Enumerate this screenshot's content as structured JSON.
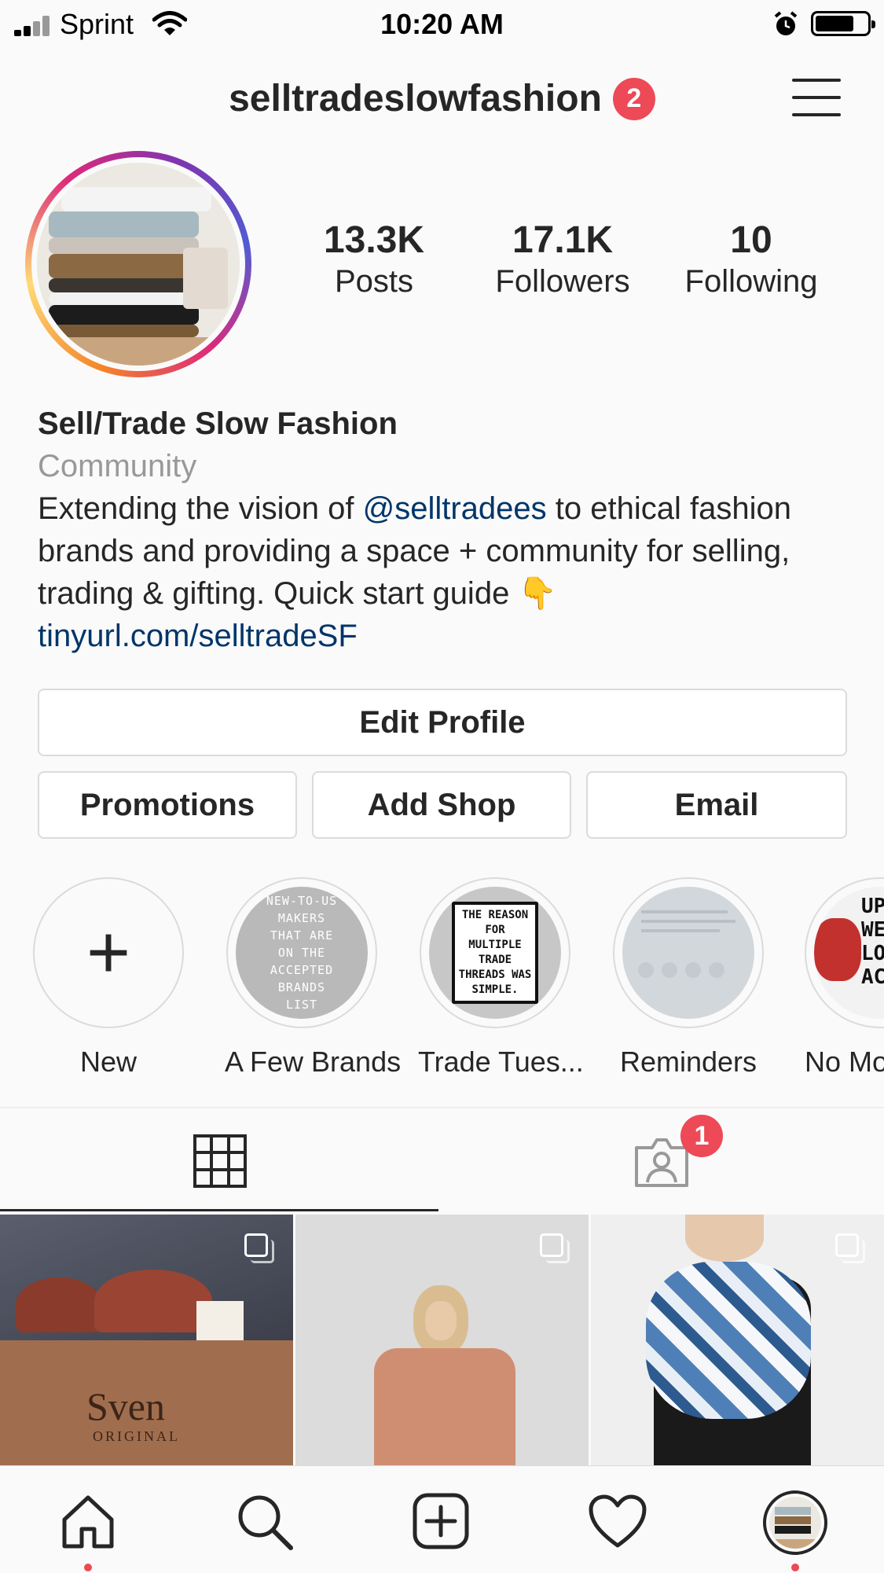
{
  "status_bar": {
    "carrier": "Sprint",
    "time": "10:20 AM"
  },
  "header": {
    "username": "selltradeslowfashion",
    "notification_count": "2"
  },
  "stats": [
    {
      "value": "13.3K",
      "label": "Posts"
    },
    {
      "value": "17.1K",
      "label": "Followers"
    },
    {
      "value": "10",
      "label": "Following"
    }
  ],
  "bio": {
    "name": "Sell/Trade Slow Fashion",
    "category": "Community",
    "text_before_mention": "Extending the vision of ",
    "mention": "@selltradees",
    "text_after_mention": " to ethical fashion brands and providing a space + community for selling, trading & gifting. Quick start guide 👇",
    "link": "tinyurl.com/selltradeSF"
  },
  "buttons": {
    "edit_profile": "Edit Profile",
    "promotions": "Promotions",
    "add_shop": "Add Shop",
    "email": "Email"
  },
  "highlights": [
    {
      "label": "New",
      "plus": "+"
    },
    {
      "label": "A Few Brands",
      "thumb_text": "NEW-TO-US MAKERS THAT ARE ON THE ACCEPTED BRANDS LIST"
    },
    {
      "label": "Trade Tues...",
      "thumb_text": "THE REASON FOR MULTIPLE TRADE THREADS WAS SIMPLE."
    },
    {
      "label": "Reminders"
    },
    {
      "label": "No Mor",
      "thumb_text": "UPD WE'R LONG ACCEP"
    }
  ],
  "tabs": {
    "tagged_notification_count": "1"
  },
  "posts": [
    {
      "thumb_text": "Sven",
      "thumb_subtext": "ORIGINAL"
    },
    {},
    {}
  ],
  "colors": {
    "accent_red": "#ed4956",
    "link_blue": "#003569",
    "text": "#262626",
    "secondary_text": "#999999"
  }
}
